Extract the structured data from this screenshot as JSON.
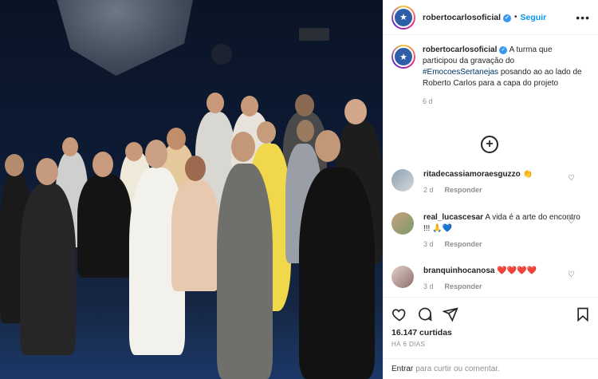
{
  "post": {
    "username": "robertocarlosoficial",
    "follow_label": "Seguir",
    "more_label": "•••",
    "caption_text_1": "A turma que participou da gravação do ",
    "caption_hashtag": "#EmocoesSertanejas",
    "caption_text_2": " posando ao ao lado de Roberto Carlos para a capa do projeto",
    "caption_age": "6 d"
  },
  "comments": [
    {
      "user": "ritadecassiamoraesguzzo",
      "text": "👏",
      "age": "2 d",
      "reply": "Responder"
    },
    {
      "user": "real_lucascesar",
      "text": "A vida é a arte do encontro !!! 🙏💙",
      "age": "3 d",
      "reply": "Responder"
    },
    {
      "user": "branquinhocanosa",
      "text": "❤️❤️❤️❤️",
      "age": "3 d",
      "reply": "Responder"
    }
  ],
  "engagement": {
    "likes": "16.147 curtidas",
    "date": "HÁ 6 DIAS"
  },
  "add_comment": {
    "enter": "Entrar",
    "rest": "para curtir ou comentar."
  },
  "colors": {
    "link": "#0095f6",
    "hashtag": "#00376b",
    "muted": "#8e8e8e"
  },
  "icons": [
    "heart-icon",
    "comment-icon",
    "share-icon",
    "bookmark-icon",
    "plus-circle-icon",
    "more-icon",
    "verified-icon"
  ]
}
